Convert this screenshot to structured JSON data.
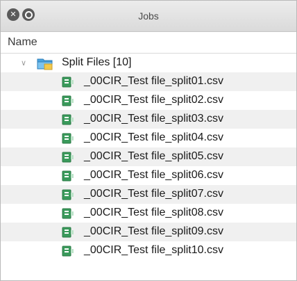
{
  "window": {
    "title": "Jobs",
    "close_glyph": "✕"
  },
  "header": {
    "column_name": "Name"
  },
  "tree": {
    "folder": {
      "label": "Split Files [10]",
      "expanded": true,
      "chevron": "∨",
      "icon": "folder-icon"
    },
    "files": [
      {
        "label": "_00CIR_Test file_split01.csv",
        "icon": "csv-file-icon"
      },
      {
        "label": "_00CIR_Test file_split02.csv",
        "icon": "csv-file-icon"
      },
      {
        "label": "_00CIR_Test file_split03.csv",
        "icon": "csv-file-icon"
      },
      {
        "label": "_00CIR_Test file_split04.csv",
        "icon": "csv-file-icon"
      },
      {
        "label": "_00CIR_Test file_split05.csv",
        "icon": "csv-file-icon"
      },
      {
        "label": "_00CIR_Test file_split06.csv",
        "icon": "csv-file-icon"
      },
      {
        "label": "_00CIR_Test file_split07.csv",
        "icon": "csv-file-icon"
      },
      {
        "label": "_00CIR_Test file_split08.csv",
        "icon": "csv-file-icon"
      },
      {
        "label": "_00CIR_Test file_split09.csv",
        "icon": "csv-file-icon"
      },
      {
        "label": "_00CIR_Test file_split10.csv",
        "icon": "csv-file-icon"
      }
    ]
  },
  "colors": {
    "row_alt": "#f0f0f0",
    "folder_blue": "#4aa3df",
    "folder_yellow": "#f2c94c",
    "file_green": "#3a9a5b"
  }
}
